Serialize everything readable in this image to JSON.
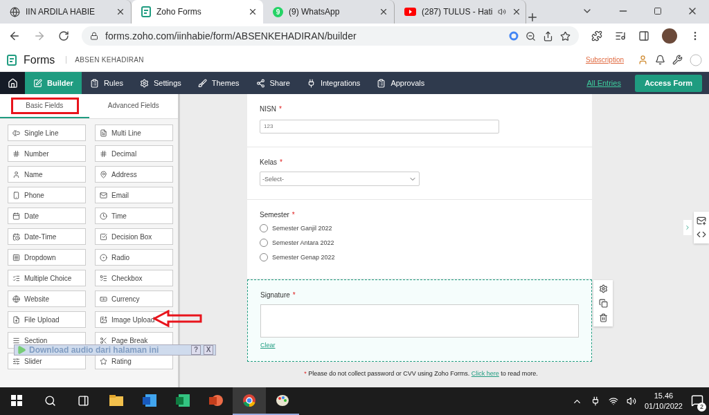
{
  "browser": {
    "tabs": [
      {
        "kind": "globe",
        "title": "IIN ARDILA HABIE",
        "selected": false
      },
      {
        "kind": "forms",
        "title": "Zoho Forms",
        "selected": true
      },
      {
        "kind": "whatsapp",
        "title": "(9) WhatsApp",
        "badge": "9",
        "selected": false
      },
      {
        "kind": "youtube",
        "title": "(287) TULUS - Hati",
        "selected": false,
        "audio": true
      }
    ],
    "url": "forms.zoho.com/iinhabie/form/ABSENKEHADIRAN/builder"
  },
  "app": {
    "brand": "Forms",
    "form_name": "ABSEN KEHADIRAN",
    "subscription": "Subscription",
    "nav": [
      {
        "label": "Builder",
        "selected": true
      },
      {
        "label": "Rules",
        "selected": false
      },
      {
        "label": "Settings",
        "selected": false
      },
      {
        "label": "Themes",
        "selected": false
      },
      {
        "label": "Share",
        "selected": false
      },
      {
        "label": "Integrations",
        "selected": false
      },
      {
        "label": "Approvals",
        "selected": false
      }
    ],
    "all_entries": "All Entries",
    "access_form": "Access Form"
  },
  "sidebar": {
    "tabs": [
      {
        "label": "Basic Fields",
        "selected": true
      },
      {
        "label": "Advanced Fields",
        "selected": false
      }
    ],
    "fields": [
      "Single Line",
      "Multi Line",
      "Number",
      "Decimal",
      "Name",
      "Address",
      "Phone",
      "Email",
      "Date",
      "Time",
      "Date-Time",
      "Decision Box",
      "Dropdown",
      "Radio",
      "Multiple Choice",
      "Checkbox",
      "Website",
      "Currency",
      "File Upload",
      "Image Upload",
      "Section",
      "Page Break",
      "Slider",
      "Rating"
    ]
  },
  "form": {
    "fields": [
      {
        "kind": "number",
        "label": "NISN",
        "required": true,
        "placeholder": "123",
        "selected": false
      },
      {
        "kind": "select",
        "label": "Kelas",
        "required": true,
        "value": "-Select-",
        "selected": false
      },
      {
        "kind": "radio",
        "label": "Semester",
        "required": true,
        "selected": false,
        "options": [
          {
            "label": "Semester Ganjil 2022",
            "selected": false
          },
          {
            "label": "Semester Antara 2022",
            "selected": false
          },
          {
            "label": "Semester Genap 2022",
            "selected": false
          }
        ]
      },
      {
        "kind": "signature",
        "label": "Signature",
        "required": true,
        "clear": "Clear",
        "selected": true
      }
    ],
    "notice": {
      "mark": "*",
      "before": "Please do not collect password or CVV using Zoho Forms.",
      "link": "Click here",
      "after": "to read more."
    }
  },
  "extension_bar": {
    "text": "Download audio dari halaman ini",
    "help": "?",
    "close": "X"
  },
  "taskbar": {
    "time": "15.46",
    "date": "01/10/2022",
    "notifications": "2"
  }
}
